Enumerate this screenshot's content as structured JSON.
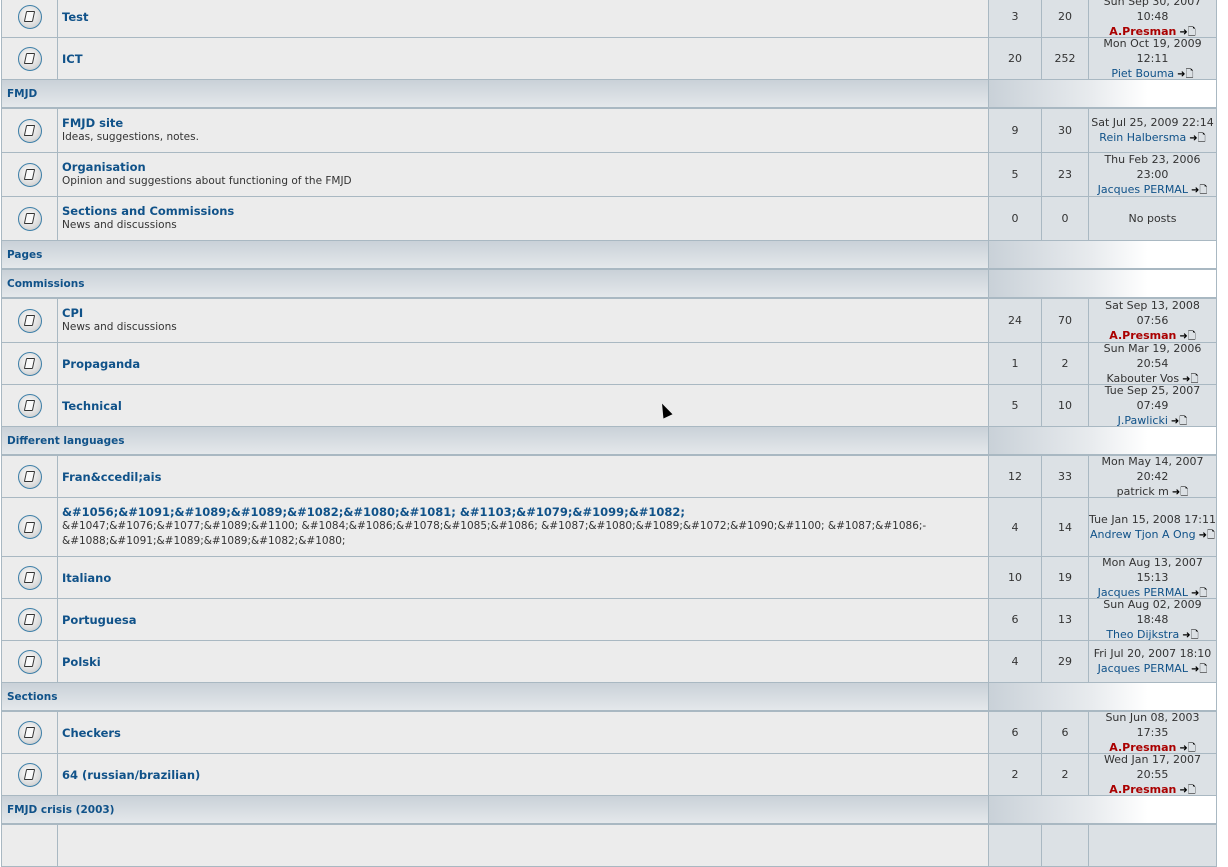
{
  "rows": [
    {
      "type": "forum",
      "name": "Test",
      "desc": "",
      "topics": "3",
      "posts": "20",
      "last_date": "Sun Sep 30, 2007 10:48",
      "last_author": "A.Presman",
      "author_style": "admin"
    },
    {
      "type": "forum",
      "name": "ICT",
      "desc": "",
      "topics": "20",
      "posts": "252",
      "last_date": "Mon Oct 19, 2009 12:11",
      "last_author": "Piet Bouma",
      "author_style": "link"
    },
    {
      "type": "cat",
      "name": "FMJD"
    },
    {
      "type": "forum",
      "name": "FMJD site",
      "desc": "Ideas, suggestions, notes.",
      "topics": "9",
      "posts": "30",
      "last_date": "Sat Jul 25, 2009 22:14",
      "last_author": "Rein Halbersma",
      "author_style": "link"
    },
    {
      "type": "forum",
      "name": "Organisation",
      "desc": "Opinion and suggestions about functioning of the FMJD",
      "topics": "5",
      "posts": "23",
      "last_date": "Thu Feb 23, 2006 23:00",
      "last_author": "Jacques PERMAL",
      "author_style": "link"
    },
    {
      "type": "forum",
      "name": "Sections and Commissions",
      "desc": "News and discussions",
      "topics": "0",
      "posts": "0",
      "no_posts": "No posts"
    },
    {
      "type": "cat",
      "name": "Pages"
    },
    {
      "type": "cat",
      "name": "Commissions"
    },
    {
      "type": "forum",
      "name": "CPI",
      "desc": "News and discussions",
      "topics": "24",
      "posts": "70",
      "last_date": "Sat Sep 13, 2008 07:56",
      "last_author": "A.Presman",
      "author_style": "admin"
    },
    {
      "type": "forum",
      "name": "Propaganda",
      "desc": "",
      "topics": "1",
      "posts": "2",
      "last_date": "Sun Mar 19, 2006 20:54",
      "last_author": "Kabouter Vos",
      "author_style": "plain"
    },
    {
      "type": "forum",
      "name": "Technical",
      "desc": "",
      "topics": "5",
      "posts": "10",
      "last_date": "Tue Sep 25, 2007 07:49",
      "last_author": "J.Pawlicki",
      "author_style": "link"
    },
    {
      "type": "cat",
      "name": "Different languages"
    },
    {
      "type": "forum",
      "name": "Fran&ccedil;ais",
      "desc": "",
      "topics": "12",
      "posts": "33",
      "last_date": "Mon May 14, 2007 20:42",
      "last_author": "patrick m",
      "author_style": "plain"
    },
    {
      "type": "forum",
      "name": "&#1056;&#1091;&#1089;&#1089;&#1082;&#1080;&#1081; &#1103;&#1079;&#1099;&#1082;",
      "desc": "&#1047;&#1076;&#1077;&#1089;&#1100; &#1084;&#1086;&#1078;&#1085;&#1086; &#1087;&#1080;&#1089;&#1072;&#1090;&#1100; &#1087;&#1086;-&#1088;&#1091;&#1089;&#1089;&#1082;&#1080;",
      "tall": true,
      "topics": "4",
      "posts": "14",
      "last_date": "Tue Jan 15, 2008 17:11",
      "last_author": "Andrew Tjon A Ong",
      "author_style": "link"
    },
    {
      "type": "forum",
      "name": "Italiano",
      "desc": "",
      "topics": "10",
      "posts": "19",
      "last_date": "Mon Aug 13, 2007 15:13",
      "last_author": "Jacques PERMAL",
      "author_style": "link"
    },
    {
      "type": "forum",
      "name": "Portuguesa",
      "desc": "",
      "topics": "6",
      "posts": "13",
      "last_date": "Sun Aug 02, 2009 18:48",
      "last_author": "Theo Dijkstra",
      "author_style": "link"
    },
    {
      "type": "forum",
      "name": "Polski",
      "desc": "",
      "topics": "4",
      "posts": "29",
      "last_date": "Fri Jul 20, 2007 18:10",
      "last_author": "Jacques PERMAL",
      "author_style": "link"
    },
    {
      "type": "cat",
      "name": "Sections"
    },
    {
      "type": "forum",
      "name": "Checkers",
      "desc": "",
      "topics": "6",
      "posts": "6",
      "last_date": "Sun Jun 08, 2003 17:35",
      "last_author": "A.Presman",
      "author_style": "admin"
    },
    {
      "type": "forum",
      "name": "64 (russian/brazilian)",
      "desc": "",
      "topics": "2",
      "posts": "2",
      "last_date": "Wed Jan 17, 2007 20:55",
      "last_author": "A.Presman",
      "author_style": "admin"
    },
    {
      "type": "cat",
      "name": "FMJD crisis (2003)"
    },
    {
      "type": "forum",
      "name": "",
      "desc": "",
      "topics": "",
      "posts": ""
    }
  ],
  "icons": {
    "forum": "forum-read-icon",
    "goto": "go-to-last-post-icon"
  },
  "goto_glyph": "➜🗋",
  "colors": {
    "link": "#105289",
    "admin": "#aa0000",
    "row": "#ececec",
    "stat": "#dce1e5",
    "border": "#a9b8c2"
  }
}
